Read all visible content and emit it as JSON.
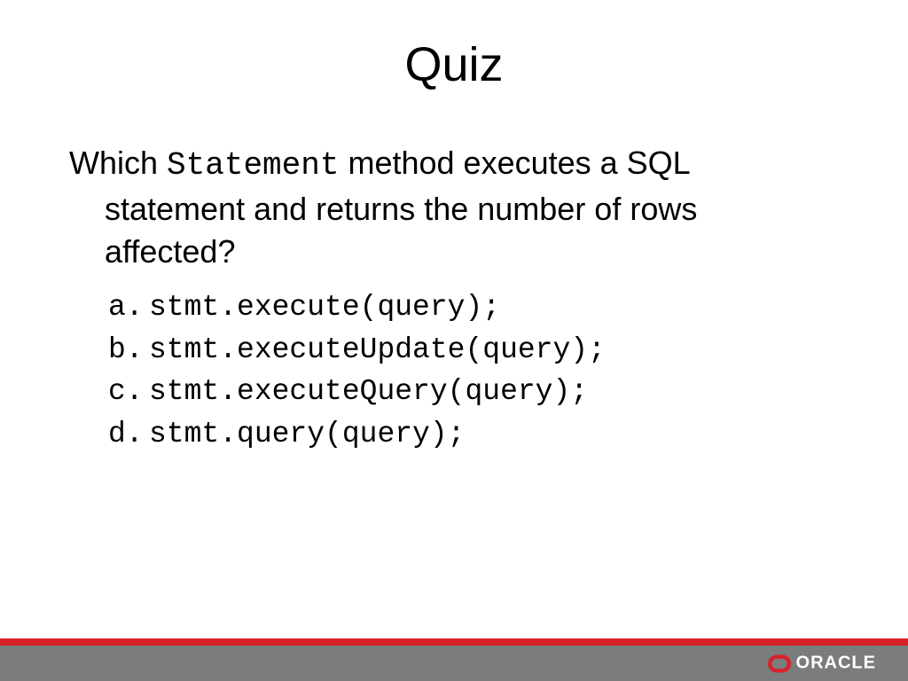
{
  "slide": {
    "title": "Quiz",
    "question": {
      "prefix": "Which ",
      "code_word": "Statement",
      "line1_suffix": " method executes a SQL",
      "line2": "statement and returns the number of rows",
      "line3": "affected?"
    },
    "options": [
      {
        "label": "a.",
        "text": "stmt.execute(query);"
      },
      {
        "label": "b.",
        "text": "stmt.executeUpdate(query);"
      },
      {
        "label": "c.",
        "text": "stmt.executeQuery(query);"
      },
      {
        "label": "d.",
        "text": "stmt.query(query);"
      }
    ],
    "footer": {
      "logo_text": "ORACLE"
    }
  }
}
